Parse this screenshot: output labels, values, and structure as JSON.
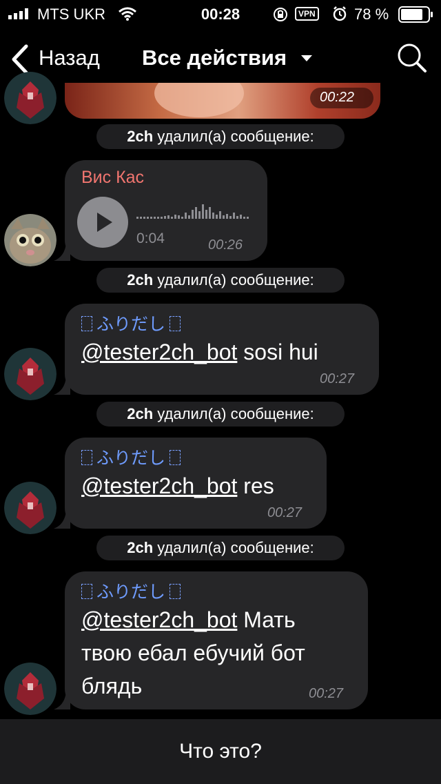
{
  "status": {
    "carrier": "MTS UKR",
    "time": "00:28",
    "vpn": "VPN",
    "battery": "78 %"
  },
  "nav": {
    "back_label": "Назад",
    "title": "Все действия"
  },
  "messages": {
    "image_msg": {
      "time": "00:22"
    },
    "service1": {
      "actor": "2ch",
      "text": "удалил(а) сообщение:"
    },
    "voice": {
      "sender": "Вис Кас",
      "duration": "0:04",
      "time": "00:26"
    },
    "service2": {
      "actor": "2ch",
      "text": "удалил(а) сообщение:"
    },
    "msg1": {
      "sender": "ふりだし",
      "mention": "@tester2ch_bot",
      "text": " sosi hui",
      "time": "00:27"
    },
    "service3": {
      "actor": "2ch",
      "text": "удалил(а) сообщение:"
    },
    "msg2": {
      "sender": "ふりだし",
      "mention": "@tester2ch_bot",
      "text": " res",
      "time": "00:27"
    },
    "service4": {
      "actor": "2ch",
      "text": "удалил(а) сообщение:"
    },
    "msg3": {
      "sender": "ふりだし",
      "mention": "@tester2ch_bot",
      "text_line1": " Мать",
      "text_line2": "твою ебал ебучий бот",
      "text_line3": "блядь",
      "time": "00:27"
    }
  },
  "bottom": {
    "label": "Что это?"
  },
  "colors": {
    "accent_sender_red": "#f0756f",
    "accent_sender_blue": "#6f9cff",
    "bubble": "#262628",
    "timestamp": "#8e8e93"
  },
  "icons": [
    "signal-icon",
    "wifi-icon",
    "orientation-lock-icon",
    "alarm-icon",
    "battery-icon",
    "back-chevron-icon",
    "search-icon",
    "play-icon"
  ]
}
